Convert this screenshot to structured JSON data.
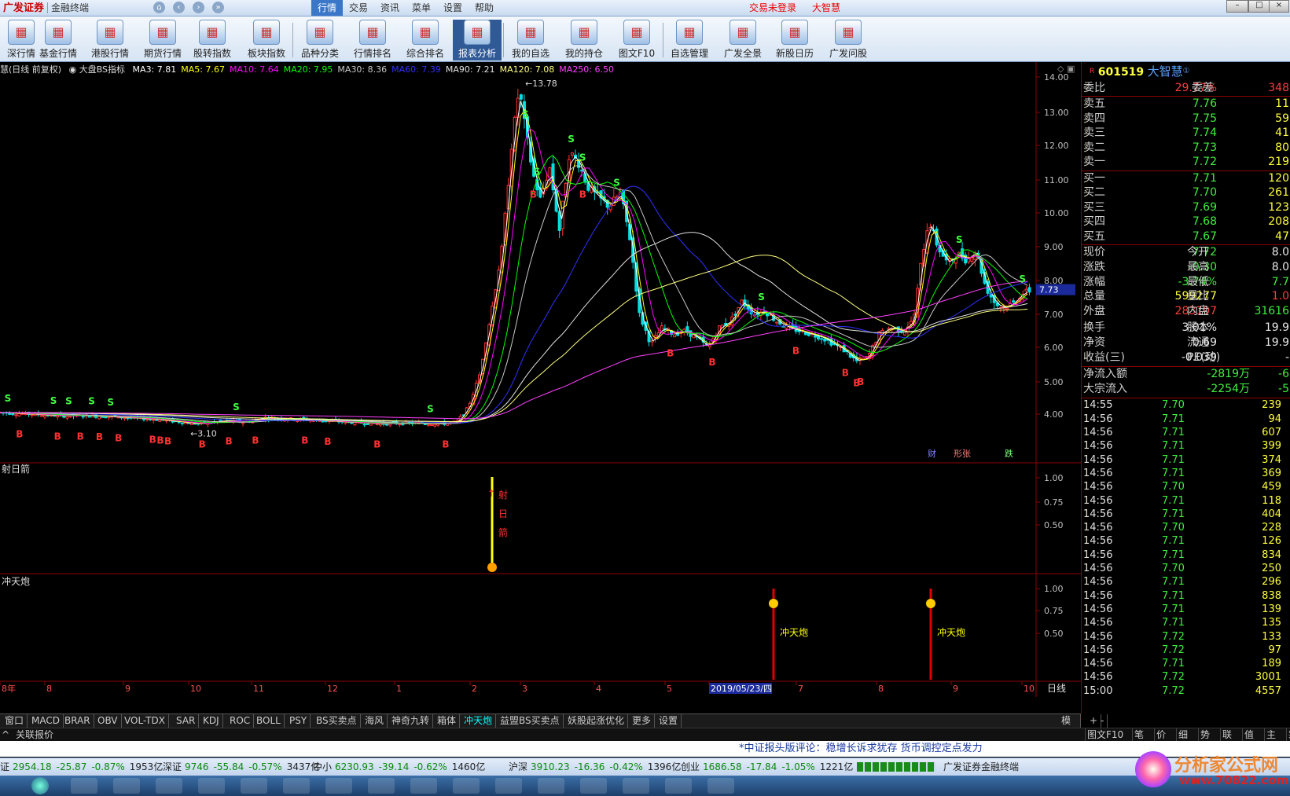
{
  "app": {
    "logo": "广发证券",
    "logo_sub": "金融终端",
    "menus": [
      "行情",
      "交易",
      "资讯",
      "菜单",
      "设置",
      "帮助"
    ],
    "active_menu": "行情",
    "trade_status": "交易未登录",
    "current_stock_name": "大智慧"
  },
  "toolbar": [
    {
      "label": "深行情",
      "icon": "chart-icon"
    },
    {
      "label": "基金行情",
      "icon": "bar-chart-icon"
    },
    {
      "label": "港股行情",
      "icon": "hk-chart-icon"
    },
    {
      "label": "期货行情",
      "icon": "futures-icon"
    },
    {
      "label": "股转指数",
      "icon": "pie-icon"
    },
    {
      "label": "板块指数",
      "icon": "sector-icon"
    },
    {
      "label": "品种分类",
      "icon": "category-icon"
    },
    {
      "label": "行情排名",
      "icon": "ranking-icon"
    },
    {
      "label": "综合排名",
      "icon": "composite-ranking-icon"
    },
    {
      "label": "报表分析",
      "icon": "report-icon"
    },
    {
      "label": "我的自选",
      "icon": "favorites-icon"
    },
    {
      "label": "我的持仓",
      "icon": "holdings-icon"
    },
    {
      "label": "图文F10",
      "icon": "f10-icon"
    },
    {
      "label": "自选管理",
      "icon": "manage-icon"
    },
    {
      "label": "广发全景",
      "icon": "panorama-icon"
    },
    {
      "label": "新股日历",
      "icon": "calendar-icon"
    },
    {
      "label": "广发问股",
      "icon": "ask-icon"
    }
  ],
  "active_toolbar": "报表分析",
  "chart_header": {
    "title": "慧(日线 前复权)",
    "indicator": "大盘BS指标",
    "ma": [
      {
        "label": "MA3: 7.81",
        "color": "#ffffff"
      },
      {
        "label": "MA5: 7.67",
        "color": "#ffff00"
      },
      {
        "label": "MA10: 7.64",
        "color": "#ff00ff"
      },
      {
        "label": "MA20: 7.95",
        "color": "#00ff00"
      },
      {
        "label": "MA30: 8.36",
        "color": "#c8c8c8"
      },
      {
        "label": "MA60: 7.39",
        "color": "#3030ff"
      },
      {
        "label": "MA90: 7.21",
        "color": "#e0e0e0"
      },
      {
        "label": "MA120: 7.08",
        "color": "#ffff80"
      },
      {
        "label": "MA250: 6.50",
        "color": "#ff40ff"
      }
    ]
  },
  "main_chart": {
    "y_ticks": [
      "14.00",
      "13.00",
      "12.00",
      "11.00",
      "10.00",
      "9.00",
      "8.00",
      "7.00",
      "6.00",
      "5.00",
      "4.00"
    ],
    "current_price_tag": "7.73",
    "high_annotation": "13.78",
    "low_annotation": "3.10",
    "flags": [
      "财",
      "形张",
      "跌"
    ]
  },
  "sub_panel_1": {
    "title": "射日箭",
    "y_ticks": [
      "1.00",
      "0.75",
      "0.50"
    ],
    "signal_label": "射日箭"
  },
  "sub_panel_2": {
    "title": "冲天炮",
    "y_ticks": [
      "1.00",
      "0.75",
      "0.50"
    ],
    "signal_label": "冲天炮"
  },
  "x_axis": {
    "labels": [
      "8年",
      "8",
      "9",
      "10",
      "11",
      "12",
      "1",
      "2",
      "3",
      "4",
      "5",
      "2019/05/23/四",
      "7",
      "8",
      "9",
      "10"
    ],
    "period": "日线"
  },
  "quote": {
    "code": "601519",
    "name": "大智慧",
    "wei_bi_label": "委比",
    "wei_bi": "29.77%",
    "wei_cha_label": "委差",
    "wei_cha": "348",
    "asks": [
      {
        "label": "卖五",
        "price": "7.76",
        "vol": "11"
      },
      {
        "label": "卖四",
        "price": "7.75",
        "vol": "59"
      },
      {
        "label": "卖三",
        "price": "7.74",
        "vol": "41"
      },
      {
        "label": "卖二",
        "price": "7.73",
        "vol": "80"
      },
      {
        "label": "卖一",
        "price": "7.72",
        "vol": "219"
      }
    ],
    "bids": [
      {
        "label": "买一",
        "price": "7.71",
        "vol": "120"
      },
      {
        "label": "买二",
        "price": "7.70",
        "vol": "261"
      },
      {
        "label": "买三",
        "price": "7.69",
        "vol": "123"
      },
      {
        "label": "买四",
        "price": "7.68",
        "vol": "208"
      },
      {
        "label": "买五",
        "price": "7.67",
        "vol": "47"
      }
    ],
    "stats": [
      {
        "l1": "现价",
        "v1": "7.72",
        "c1": "green",
        "l2": "今开",
        "v2": "8.0",
        "c2": "white"
      },
      {
        "l1": "涨跌",
        "v1": "-0.30",
        "c1": "green",
        "l2": "最高",
        "v2": "8.0",
        "c2": "white"
      },
      {
        "l1": "涨幅",
        "v1": "-3.74%",
        "c1": "green",
        "l2": "最低",
        "v2": "7.7",
        "c2": "green"
      },
      {
        "l1": "总量",
        "v1": "599277",
        "c1": "yellow",
        "l2": "量比",
        "v2": "1.0",
        "c2": "red"
      },
      {
        "l1": "外盘",
        "v1": "283107",
        "c1": "red",
        "l2": "内盘",
        "v2": "31616",
        "c2": "green"
      },
      {
        "l1": "换手",
        "v1": "3.01%",
        "c1": "white",
        "l2": "股本",
        "v2": "19.9",
        "c2": "white"
      },
      {
        "l1": "净资",
        "v1": "0.69",
        "c1": "white",
        "l2": "流通",
        "v2": "19.9",
        "c2": "white"
      },
      {
        "l1": "收益(三)",
        "v1": "-0.039",
        "c1": "white",
        "l2": "PE(动)",
        "v2": "-",
        "c2": "white"
      }
    ],
    "flows": [
      {
        "label": "净流入额",
        "v1": "-2819万",
        "v2": "-6"
      },
      {
        "label": "大宗流入",
        "v1": "-2254万",
        "v2": "-5"
      }
    ],
    "ticks": [
      {
        "t": "14:55",
        "p": "7.70",
        "q": "239",
        "c": "yellow"
      },
      {
        "t": "14:56",
        "p": "7.71",
        "q": "94",
        "c": "yellow"
      },
      {
        "t": "14:56",
        "p": "7.71",
        "q": "607",
        "c": "magenta"
      },
      {
        "t": "14:56",
        "p": "7.71",
        "q": "399",
        "c": "yellow"
      },
      {
        "t": "14:56",
        "p": "7.71",
        "q": "374",
        "c": "yellow"
      },
      {
        "t": "14:56",
        "p": "7.71",
        "q": "369",
        "c": "yellow"
      },
      {
        "t": "14:56",
        "p": "7.70",
        "q": "459",
        "c": "yellow"
      },
      {
        "t": "14:56",
        "p": "7.71",
        "q": "118",
        "c": "yellow"
      },
      {
        "t": "14:56",
        "p": "7.71",
        "q": "404",
        "c": "yellow"
      },
      {
        "t": "14:56",
        "p": "7.70",
        "q": "228",
        "c": "yellow"
      },
      {
        "t": "14:56",
        "p": "7.71",
        "q": "126",
        "c": "yellow"
      },
      {
        "t": "14:56",
        "p": "7.71",
        "q": "834",
        "c": "magenta"
      },
      {
        "t": "14:56",
        "p": "7.70",
        "q": "250",
        "c": "yellow"
      },
      {
        "t": "14:56",
        "p": "7.71",
        "q": "296",
        "c": "yellow"
      },
      {
        "t": "14:56",
        "p": "7.71",
        "q": "838",
        "c": "magenta"
      },
      {
        "t": "14:56",
        "p": "7.71",
        "q": "139",
        "c": "yellow"
      },
      {
        "t": "14:56",
        "p": "7.71",
        "q": "135",
        "c": "yellow"
      },
      {
        "t": "14:56",
        "p": "7.72",
        "q": "133",
        "c": "yellow"
      },
      {
        "t": "14:56",
        "p": "7.72",
        "q": "97",
        "c": "yellow"
      },
      {
        "t": "14:56",
        "p": "7.71",
        "q": "189",
        "c": "yellow"
      },
      {
        "t": "14:56",
        "p": "7.72",
        "q": "3001",
        "c": "magenta"
      },
      {
        "t": "15:00",
        "p": "7.72",
        "q": "4557",
        "c": "magenta"
      }
    ]
  },
  "bottom_tabs": [
    "窗口",
    "MACD",
    "BRAR",
    "OBV",
    "VOL-TDX",
    "SAR",
    "KDJ",
    "ROC",
    "BOLL",
    "PSY",
    "BS买卖点",
    "海风",
    "神奇九转",
    "箱体",
    "冲天炮",
    "益盟BS买卖点",
    "妖股起涨优化",
    "更多",
    "设置"
  ],
  "active_tab": "冲天炮",
  "bottom_right_tabs": [
    "模板",
    "+",
    "-"
  ],
  "sub_bar": {
    "left": [
      "^",
      "关联报价"
    ],
    "right": [
      "图文F10",
      "笔",
      "价",
      "细",
      "势",
      "联",
      "值",
      "主",
      "筹"
    ]
  },
  "news": "*中证报头版评论：稳增长诉求犹存 货币调控定点发力",
  "index_bar": [
    {
      "name": "证",
      "val": "2954.18",
      "chg": "-25.87",
      "pct": "-0.87%",
      "amt": "1953亿"
    },
    {
      "name": "深证",
      "val": "9746",
      "chg": "-55.84",
      "pct": "-0.57%",
      "amt": "3437亿"
    },
    {
      "name": "中小",
      "val": "6230.93",
      "chg": "-39.14",
      "pct": "-0.62%",
      "amt": "1460亿"
    },
    {
      "name": "沪深",
      "val": "3910.23",
      "chg": "-16.36",
      "pct": "-0.42%",
      "amt": "1396亿"
    },
    {
      "name": "创业",
      "val": "1686.58",
      "chg": "-17.84",
      "pct": "-1.05%",
      "amt": "1221亿"
    }
  ],
  "brand_footer": "广发证券金融终端",
  "watermark": {
    "title": "分析家公式网",
    "url": "www.70822.com"
  }
}
